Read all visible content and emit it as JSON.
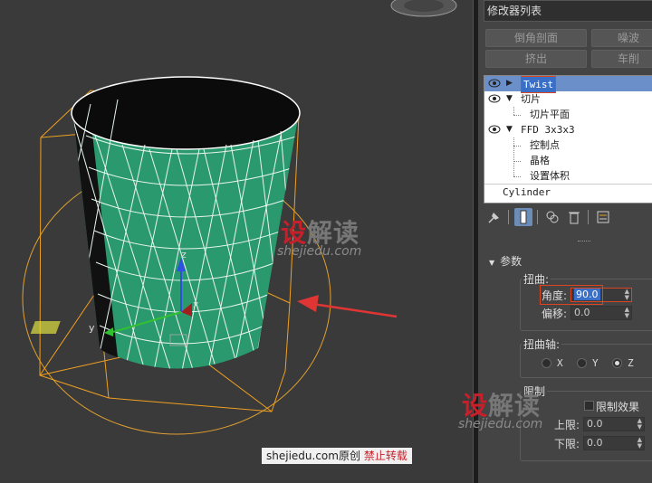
{
  "modifier_panel": {
    "title": "修改器列表",
    "buttons": [
      "倒角剖面",
      "噪波",
      "挤出",
      "车削"
    ],
    "stack": {
      "items": [
        {
          "label": "Twist"
        },
        {
          "label": "切片"
        },
        {
          "label": "切片平面"
        },
        {
          "label": "FFD 3x3x3"
        },
        {
          "label": "控制点"
        },
        {
          "label": "晶格"
        },
        {
          "label": "设置体积"
        },
        {
          "label": "Cylinder"
        }
      ]
    },
    "params": {
      "section_title": "参数",
      "twist_group": "扭曲:",
      "angle_label": "角度:",
      "angle_value": "90.0",
      "bias_label": "偏移:",
      "bias_value": "0.0",
      "axis_group": "扭曲轴:",
      "axes": [
        "X",
        "Y",
        "Z"
      ],
      "selected_axis": "Z",
      "limits_group": "限制",
      "limit_effect": "限制效果",
      "upper_label": "上限:",
      "upper_value": "0.0",
      "lower_label": "下限:",
      "lower_value": "0.0"
    }
  },
  "viewport": {
    "axis_labels": {
      "x": "x",
      "y": "y",
      "z": "z"
    }
  },
  "watermark": {
    "logo_chars": [
      "设",
      "解",
      "读"
    ],
    "url": "shejiedu.com",
    "copyright_site": "shejiedu.com",
    "copyright_text": "原创",
    "copyright_warning": "禁止转载"
  }
}
